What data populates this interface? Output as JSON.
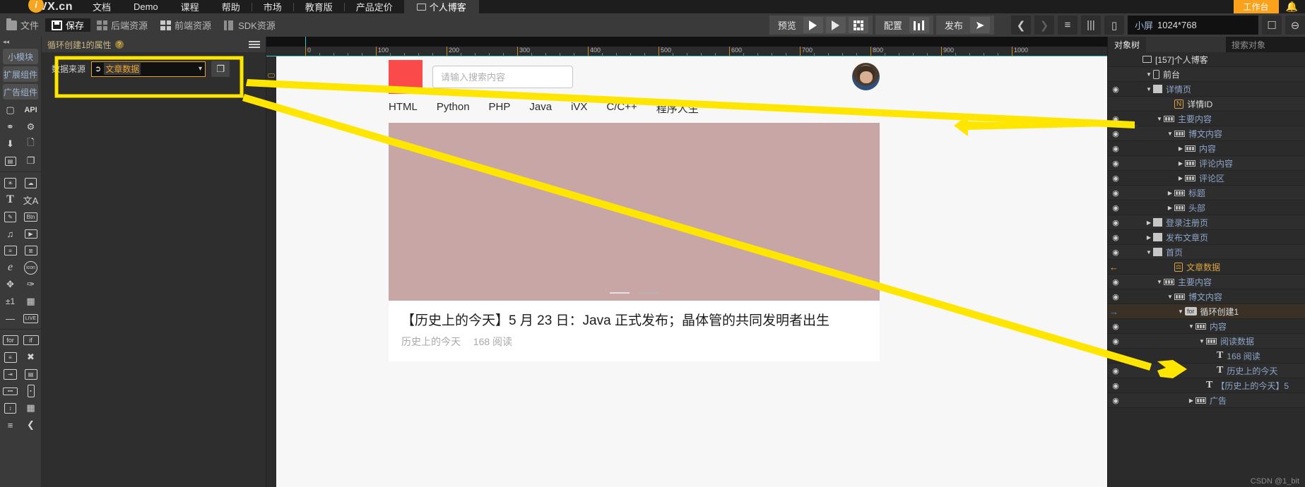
{
  "topbar": {
    "brand": "VX.cn",
    "nav": [
      "文档",
      "Demo",
      "课程",
      "帮助",
      "市场",
      "教育版",
      "产品定价"
    ],
    "active_tab": "个人博客",
    "action_button": "工作台",
    "bell_icon": "bell-icon"
  },
  "toolbar": {
    "file": "文件",
    "save": "保存",
    "backend": "后端资源",
    "frontend": "前端资源",
    "sdk": "SDK资源",
    "preview_label": "预览",
    "config_label": "配置",
    "publish_label": "发布",
    "screen_label": "小屏",
    "screen_value": "1024*768"
  },
  "rail": {
    "chips": [
      "小模块",
      "扩展组件",
      "广告组件"
    ],
    "icons_group1": [
      "box-icon",
      "api-icon",
      "share-nodes-icon",
      "gear-icon",
      "download-icon",
      "file-upload-icon",
      "webpage-icon",
      "copy-page-icon"
    ],
    "icons_group2": [
      "image-icon",
      "image-stack-icon",
      "text-icon",
      "translate-icon",
      "edit-icon",
      "button-icon",
      "music-icon",
      "video-icon",
      "list-card-icon",
      "news-card-icon",
      "editor-icon",
      "icon-circle-icon",
      "move-icon",
      "brush-icon",
      "plusminus-one-icon",
      "qrcode-icon",
      "line-icon",
      "live-icon"
    ],
    "icons_group3": [
      "for-loop-icon",
      "if-icon",
      "condition-icon",
      "shuffle-icon",
      "slide-in-icon",
      "layer-icon",
      "progress-icon",
      "slider-vertical-icon",
      "sort-icon",
      "table-icon",
      "tree-icon",
      "flow-icon"
    ]
  },
  "properties": {
    "title": "循环创建1的属性",
    "help_icon": "question-icon",
    "menu_icon": "hamburger-icon",
    "data_source_label": "数据来源",
    "data_source_value": "文章数据",
    "copy_icon": "copy-icon",
    "dropdown_icon": "chevron-down-icon"
  },
  "canvas": {
    "ruler_ticks": [
      "0",
      "100",
      "200",
      "300",
      "400",
      "500",
      "600",
      "700",
      "800",
      "900",
      "1000"
    ],
    "preview": {
      "logo": "logo-square",
      "search_placeholder": "请输入搜索内容",
      "avatar": "user-avatar",
      "nav_tabs": [
        "HTML",
        "Python",
        "PHP",
        "Java",
        "iVX",
        "C/C++",
        "程序人生"
      ],
      "article_title": "【历史上的今天】5 月 23 日：Java 正式发布；晶体管的共同发明者出生",
      "article_author": "历史上的今天",
      "article_reads": "168 阅读"
    }
  },
  "tree": {
    "title": "对象树",
    "search_placeholder": "搜索对象",
    "watermark": "CSDN @1_bit",
    "rows": [
      {
        "label": "[157]个人博客",
        "icon": "screen-icon",
        "indent": 1,
        "eye": false,
        "arrow": "",
        "color": "white"
      },
      {
        "label": "前台",
        "icon": "phone-icon",
        "indent": 2,
        "eye": false,
        "arrow": "down",
        "color": "white"
      },
      {
        "label": "详情页",
        "icon": "page-icon",
        "indent": 2,
        "eye": true,
        "arrow": "down",
        "color": "blue"
      },
      {
        "label": "详情ID",
        "icon": "n-badge-icon",
        "indent": 4,
        "eye": false,
        "arrow": "",
        "color": "white"
      },
      {
        "label": "主要内容",
        "icon": "group-icon",
        "indent": 3,
        "eye": true,
        "arrow": "down",
        "color": "blue"
      },
      {
        "label": "博文内容",
        "icon": "group-icon",
        "indent": 4,
        "eye": true,
        "arrow": "down",
        "color": "blue"
      },
      {
        "label": "内容",
        "icon": "group-icon",
        "indent": 5,
        "eye": true,
        "arrow": "right",
        "color": "blue"
      },
      {
        "label": "评论内容",
        "icon": "group-icon",
        "indent": 5,
        "eye": true,
        "arrow": "right",
        "color": "blue"
      },
      {
        "label": "评论区",
        "icon": "group-icon",
        "indent": 5,
        "eye": true,
        "arrow": "right",
        "color": "blue"
      },
      {
        "label": "标题",
        "icon": "group-icon",
        "indent": 4,
        "eye": true,
        "arrow": "right",
        "color": "blue"
      },
      {
        "label": "头部",
        "icon": "group-icon",
        "indent": 4,
        "eye": true,
        "arrow": "right",
        "color": "blue"
      },
      {
        "label": "登录注册页",
        "icon": "page-icon",
        "indent": 2,
        "eye": true,
        "arrow": "right",
        "color": "blue"
      },
      {
        "label": "发布文章页",
        "icon": "page-icon",
        "indent": 2,
        "eye": true,
        "arrow": "right",
        "color": "blue"
      },
      {
        "label": "首页",
        "icon": "page-icon",
        "indent": 2,
        "eye": true,
        "arrow": "down",
        "color": "blue"
      },
      {
        "label": "文章数据",
        "icon": "data-icon",
        "indent": 4,
        "eye": false,
        "arrow": "",
        "color": "orange",
        "mark": "left-arrow"
      },
      {
        "label": "主要内容",
        "icon": "group-icon",
        "indent": 3,
        "eye": true,
        "arrow": "down",
        "color": "blue"
      },
      {
        "label": "博文内容",
        "icon": "group-icon",
        "indent": 4,
        "eye": true,
        "arrow": "down",
        "color": "blue"
      },
      {
        "label": "循环创建1",
        "icon": "for-icon",
        "indent": 5,
        "eye": false,
        "arrow": "down",
        "color": "white",
        "selected": true,
        "mark": "blue-arrow"
      },
      {
        "label": "内容",
        "icon": "group-icon",
        "indent": 6,
        "eye": true,
        "arrow": "down",
        "color": "blue"
      },
      {
        "label": "阅读数据",
        "icon": "group-icon",
        "indent": 7,
        "eye": true,
        "arrow": "down",
        "color": "blue"
      },
      {
        "label": "168 阅读",
        "icon": "text-icon",
        "indent": 8,
        "eye": true,
        "arrow": "",
        "color": "blue"
      },
      {
        "label": "历史上的今天",
        "icon": "text-icon",
        "indent": 8,
        "eye": true,
        "arrow": "",
        "color": "blue"
      },
      {
        "label": "【历史上的今天】5",
        "icon": "text-icon",
        "indent": 7,
        "eye": true,
        "arrow": "",
        "color": "blue"
      },
      {
        "label": "广告",
        "icon": "group-icon",
        "indent": 6,
        "eye": true,
        "arrow": "right",
        "color": "blue"
      }
    ]
  },
  "annotations": {
    "highlight_color": "#ffe600",
    "arrow_count": 2
  }
}
